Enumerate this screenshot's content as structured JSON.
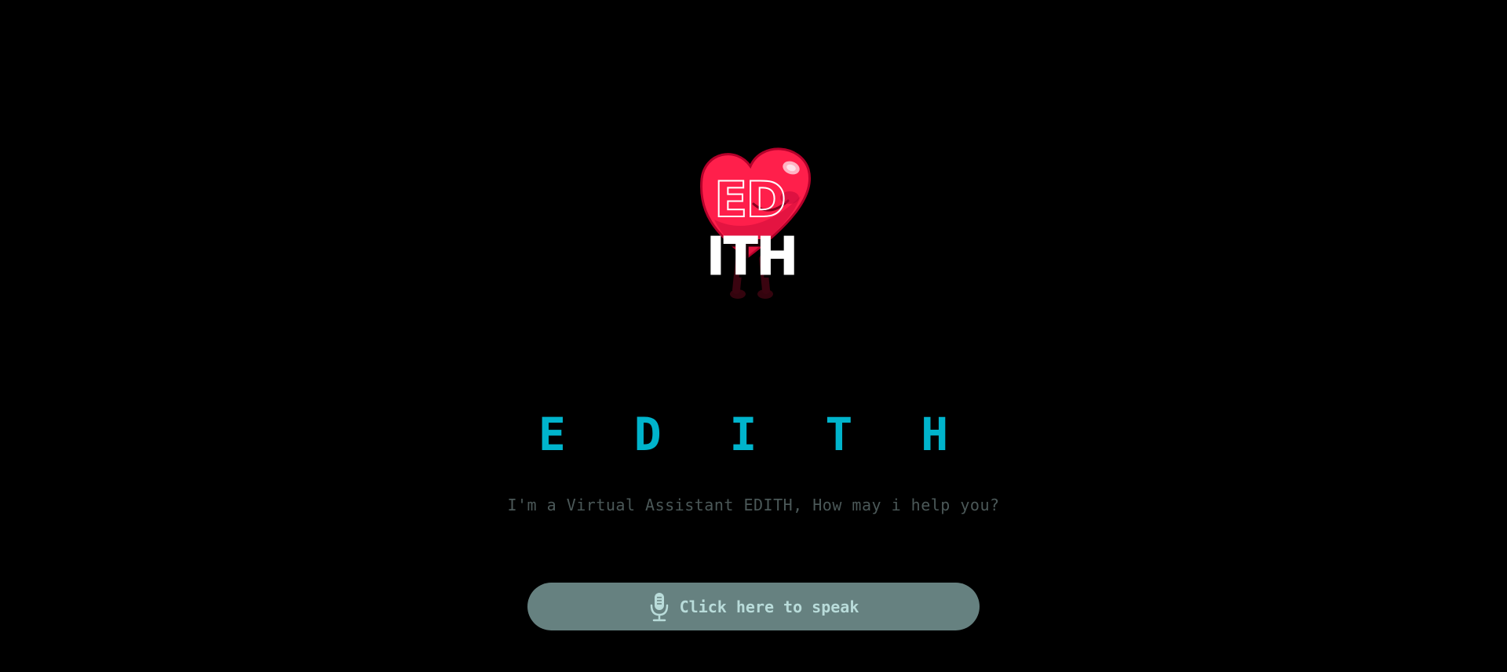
{
  "logo": {
    "text_line1": "ED",
    "text_line2": "ITH",
    "heart_color": "#ff1f4b"
  },
  "title": "E D I T H",
  "subtitle": "I'm a Virtual Assistant EDITH, How may i help you?",
  "speak_button": {
    "label": "Click here to speak",
    "icon": "microphone-icon"
  },
  "colors": {
    "background": "#000000",
    "accent": "#00b4cc",
    "button_bg": "#668180",
    "button_text": "#b9dcda",
    "subtitle": "#4b5858"
  }
}
